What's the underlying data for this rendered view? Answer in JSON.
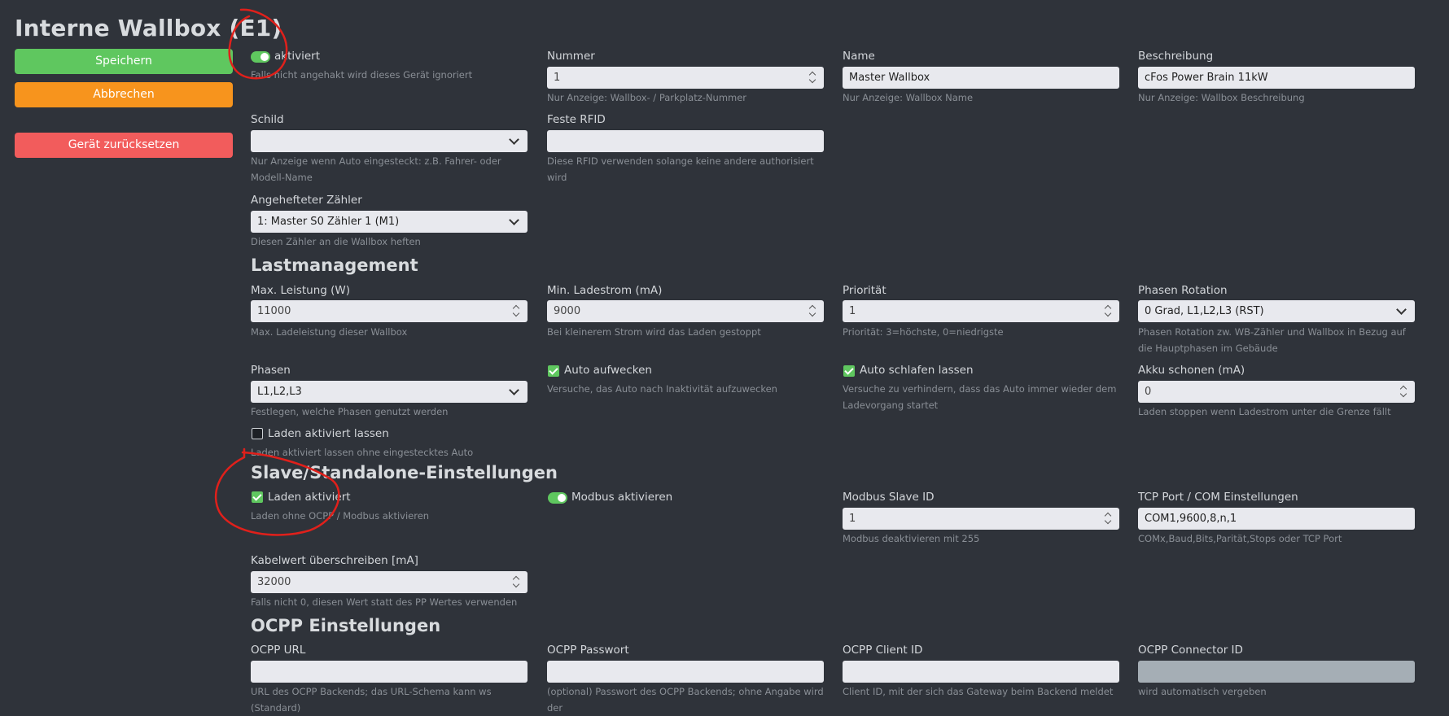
{
  "page": {
    "title": "Interne Wallbox (E1)"
  },
  "buttons": {
    "save": "Speichern",
    "cancel": "Abbrechen",
    "reset": "Gerät zurücksetzen"
  },
  "general": {
    "enabled_label": "aktiviert",
    "enabled_help": "Falls nicht angehakt wird dieses Gerät ignoriert",
    "nummer": {
      "label": "Nummer",
      "value": "1",
      "help": "Nur Anzeige: Wallbox- / Parkplatz-Nummer"
    },
    "name": {
      "label": "Name",
      "value": "Master Wallbox",
      "help": "Nur Anzeige: Wallbox Name"
    },
    "beschreibung": {
      "label": "Beschreibung",
      "value": "cFos Power Brain 11kW",
      "help": "Nur Anzeige: Wallbox Beschreibung"
    },
    "schild": {
      "label": "Schild",
      "value": "",
      "help": "Nur Anzeige wenn Auto eingesteckt: z.B. Fahrer- oder Modell-Name"
    },
    "rfid": {
      "label": "Feste RFID",
      "value": "",
      "help": "Diese RFID verwenden solange keine andere authorisiert wird"
    },
    "zaehler": {
      "label": "Angehefteter Zähler",
      "value": "1: Master S0 Zähler 1 (M1)",
      "help": "Diesen Zähler an die Wallbox heften"
    }
  },
  "load": {
    "title": "Lastmanagement",
    "max_power": {
      "label": "Max. Leistung (W)",
      "value": "11000",
      "help": "Max. Ladeleistung dieser Wallbox"
    },
    "min_current": {
      "label": "Min. Ladestrom (mA)",
      "value": "9000",
      "help": "Bei kleinerem Strom wird das Laden gestoppt"
    },
    "priority": {
      "label": "Priorität",
      "value": "1",
      "help": "Priorität: 3=höchste, 0=niedrigste"
    },
    "rotation": {
      "label": "Phasen Rotation",
      "value": "0 Grad, L1,L2,L3 (RST)",
      "help": "Phasen Rotation zw. WB-Zähler und Wallbox in Bezug auf die Hauptphasen im Gebäude"
    },
    "phases": {
      "label": "Phasen",
      "value": "L1,L2,L3",
      "help": "Festlegen, welche Phasen genutzt werden"
    },
    "wake": {
      "label": "Auto aufwecken",
      "help": "Versuche, das Auto nach Inaktivität aufzuwecken"
    },
    "sleep": {
      "label": "Auto schlafen lassen",
      "help": "Versuche zu verhindern, dass das Auto immer wieder dem Ladevorgang startet"
    },
    "battery": {
      "label": "Akku schonen (mA)",
      "value": "0",
      "help": "Laden stoppen wenn Ladestrom unter die Grenze fällt"
    },
    "keep": {
      "label": "Laden aktiviert lassen",
      "help": "Laden aktiviert lassen ohne eingestecktes Auto"
    }
  },
  "slave": {
    "title": "Slave/Standalone-Einstellungen",
    "charge": {
      "label": "Laden aktiviert",
      "help": "Laden ohne OCPP / Modbus aktivieren"
    },
    "modbus": {
      "label": "Modbus aktivieren"
    },
    "slave_id": {
      "label": "Modbus Slave ID",
      "value": "1",
      "help": "Modbus deaktivieren mit 255"
    },
    "tcp": {
      "label": "TCP Port / COM Einstellungen",
      "value": "COM1,9600,8,n,1",
      "help": "COMx,Baud,Bits,Parität,Stops oder TCP Port"
    },
    "cable": {
      "label": "Kabelwert überschreiben [mA]",
      "value": "32000",
      "help": "Falls nicht 0, diesen Wert statt des PP Wertes verwenden"
    }
  },
  "ocpp": {
    "title": "OCPP Einstellungen",
    "url": {
      "label": "OCPP URL",
      "value": "",
      "help": "URL des OCPP Backends; das URL-Schema kann ws (Standard)"
    },
    "password": {
      "label": "OCPP Passwort",
      "value": "",
      "help": "(optional) Passwort des OCPP Backends; ohne Angabe wird der"
    },
    "client": {
      "label": "OCPP Client ID",
      "value": "",
      "help": "Client ID, mit der sich das Gateway beim Backend meldet"
    },
    "connector": {
      "label": "OCPP Connector ID",
      "value": "",
      "help": "wird automatisch vergeben"
    }
  },
  "colors": {
    "background": "#2f333a",
    "green": "#5fc75f",
    "orange": "#f7941d",
    "red": "#f25c5c",
    "annotation": "#e0201b"
  }
}
